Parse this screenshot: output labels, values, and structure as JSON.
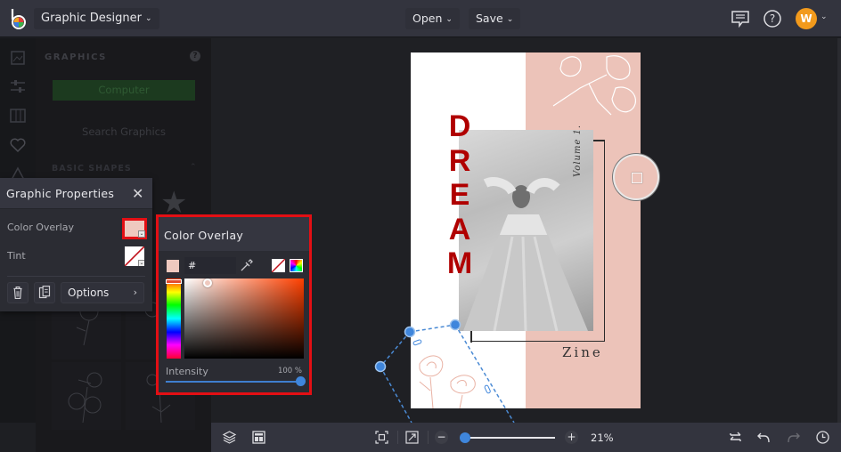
{
  "topbar": {
    "app_name": "Graphic Designer",
    "open_label": "Open",
    "save_label": "Save",
    "icons": [
      "logo-icon",
      "comments-icon",
      "help-icon"
    ],
    "avatar_initial": "W",
    "avatar_color": "#f29a1c"
  },
  "left_rail": {
    "icons": [
      "image-icon",
      "sliders-icon",
      "columns-icon",
      "heart-icon",
      "shapes-icon"
    ]
  },
  "graphics_panel": {
    "title": "GRAPHICS",
    "computer_button": "Computer",
    "search_placeholder": "Search Graphics",
    "section_basic_shapes": "BASIC SHAPES"
  },
  "graphic_properties": {
    "title": "Graphic Properties",
    "color_overlay_label": "Color Overlay",
    "tint_label": "Tint",
    "options_label": "Options",
    "color_overlay_value": "#EFC9BF"
  },
  "color_overlay_popup": {
    "title": "Color Overlay",
    "hex_value": "# EFC9BF",
    "intensity_label": "Intensity",
    "intensity_value": "100 %",
    "intensity_fraction": 1.0,
    "highlight_color": "#e30f14"
  },
  "canvas": {
    "title_letters": [
      "D",
      "R",
      "E",
      "A",
      "M"
    ],
    "volume_text": "Volume 1.",
    "zine_text": "Zine",
    "page_pink": "#ecc3b9",
    "title_color": "#b00000"
  },
  "bottombar": {
    "zoom_value": "21%",
    "zoom_fraction": 0.21,
    "icons": [
      "layers-icon",
      "layout-icon",
      "fit-screen-icon",
      "expand-icon",
      "zoom-out-icon",
      "zoom-in-icon",
      "swap-icon",
      "undo-icon",
      "redo-icon",
      "history-icon"
    ]
  }
}
